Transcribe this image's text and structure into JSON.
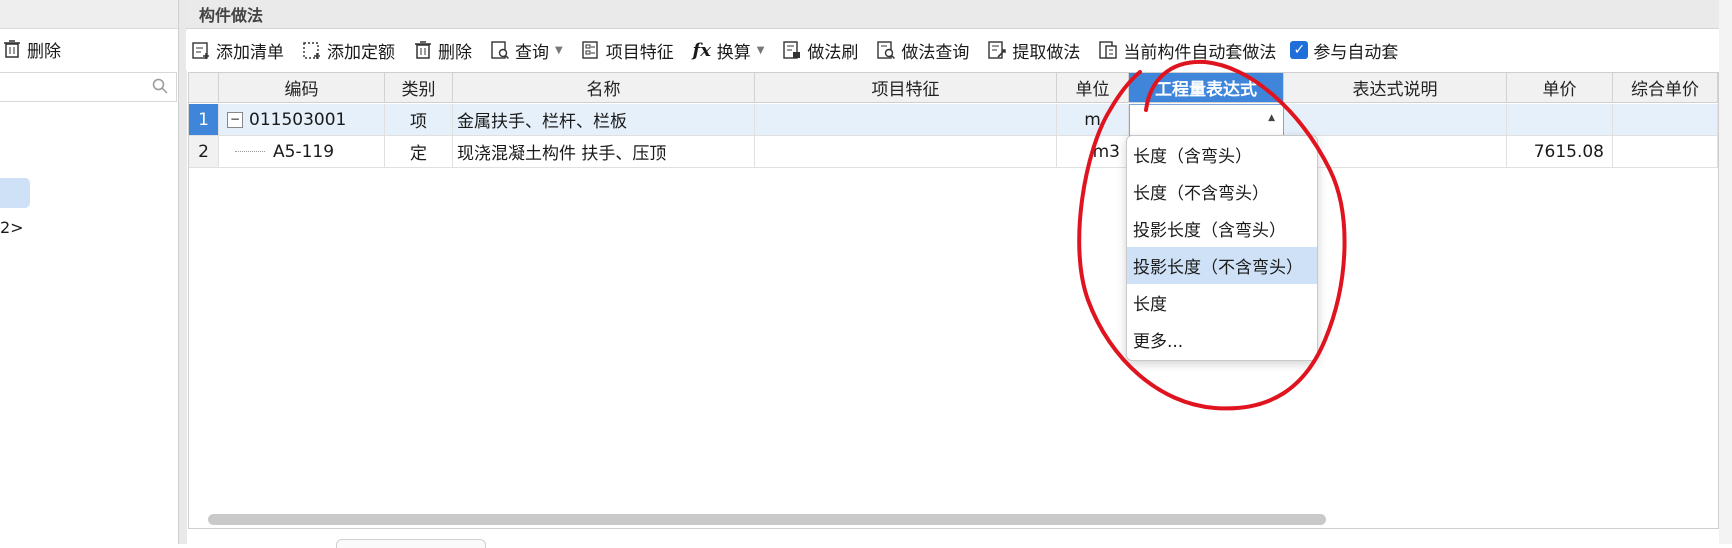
{
  "left_panel": {
    "delete_label": "删除",
    "search_placeholder": "",
    "item_text": "2>"
  },
  "panel_title": "构件做法",
  "toolbar": {
    "add_list": "添加清单",
    "add_quota": "添加定额",
    "delete": "删除",
    "query": "查询",
    "item_feature": "项目特征",
    "convert": "换算",
    "method_brush": "做法刷",
    "method_query": "做法查询",
    "extract_method": "提取做法",
    "auto_method": "当前构件自动套做法",
    "auto_checkbox": "参与自动套",
    "auto_checked": true
  },
  "grid": {
    "columns": [
      "编码",
      "类别",
      "名称",
      "项目特征",
      "单位",
      "工程量表达式",
      "表达式说明",
      "单价",
      "综合单价"
    ],
    "selected_column": "工程量表达式",
    "rows": [
      {
        "num": "1",
        "code": "011503001",
        "type": "项",
        "name": "金属扶手、栏杆、栏板",
        "feature": "",
        "unit": "m",
        "expr": "",
        "desc": "",
        "price": "",
        "total": ""
      },
      {
        "num": "2",
        "code": "A5-119",
        "type": "定",
        "name": "现浇混凝土构件 扶手、压顶",
        "feature": "",
        "unit": "m3",
        "expr": "",
        "desc": "",
        "price": "7615.08",
        "total": ""
      }
    ]
  },
  "dropdown": {
    "options": [
      "长度（含弯头）",
      "长度（不含弯头）",
      "投影长度（含弯头）",
      "投影长度（不含弯头）",
      "长度",
      "更多..."
    ],
    "highlighted_index": 3
  },
  "colors": {
    "accent": "#3f86da",
    "highlight": "#cfe1f7",
    "annotation": "#e0141e",
    "icon": "#333333"
  }
}
